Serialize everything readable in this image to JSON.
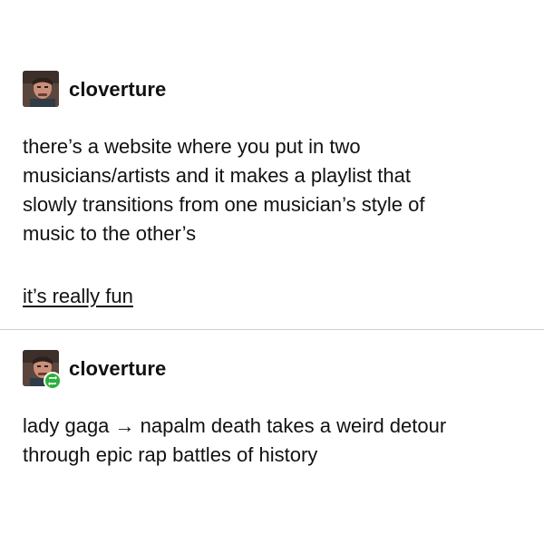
{
  "post1": {
    "username": "cloverture",
    "avatar_icon": "avatar-icon",
    "body_lines": [
      "there’s a website where you put in two",
      "musicians/artists and it makes a playlist that",
      "slowly transitions from one musician’s style of",
      "music to the other’s"
    ],
    "link_text": "it’s really fun"
  },
  "post2": {
    "username": "cloverture",
    "avatar_icon": "avatar-icon",
    "reblog_icon": "reblog-icon",
    "reblog_color": "#2bb03a",
    "body_lines": [
      "lady gaga → napalm death takes a weird detour",
      "through epic rap battles of history"
    ]
  }
}
